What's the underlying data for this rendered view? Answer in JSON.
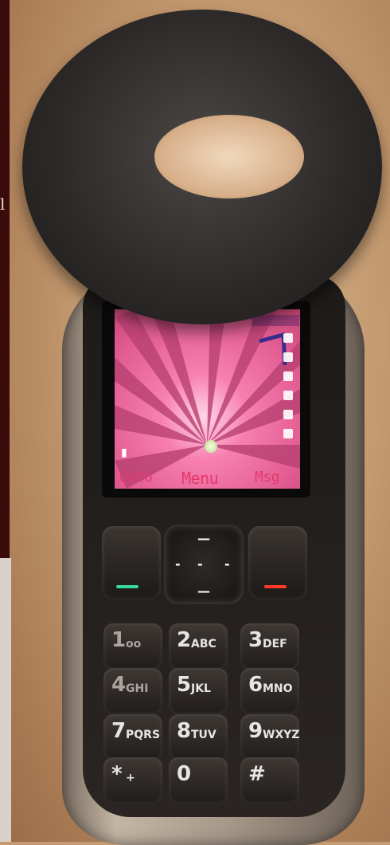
{
  "left_edge": {
    "char": "l"
  },
  "phone": {
    "softkeys": {
      "left": "Goto",
      "center": "Menu",
      "right": "Msg"
    },
    "keys": [
      {
        "num": "1",
        "sub": "oo"
      },
      {
        "num": "2",
        "sub": "ABC"
      },
      {
        "num": "3",
        "sub": "DEF"
      },
      {
        "num": "4",
        "sub": "GHI"
      },
      {
        "num": "5",
        "sub": "JKL"
      },
      {
        "num": "6",
        "sub": "MNO"
      },
      {
        "num": "7",
        "sub": "PQRS"
      },
      {
        "num": "8",
        "sub": "TUV"
      },
      {
        "num": "9",
        "sub": "WXYZ"
      },
      {
        "num": "*",
        "sub": "+"
      },
      {
        "num": "0",
        "sub": ""
      },
      {
        "num": "#",
        "sub": ""
      }
    ],
    "colors": {
      "screen_pink": "#f06a9f",
      "softkey_text": "#e23b6a"
    }
  }
}
